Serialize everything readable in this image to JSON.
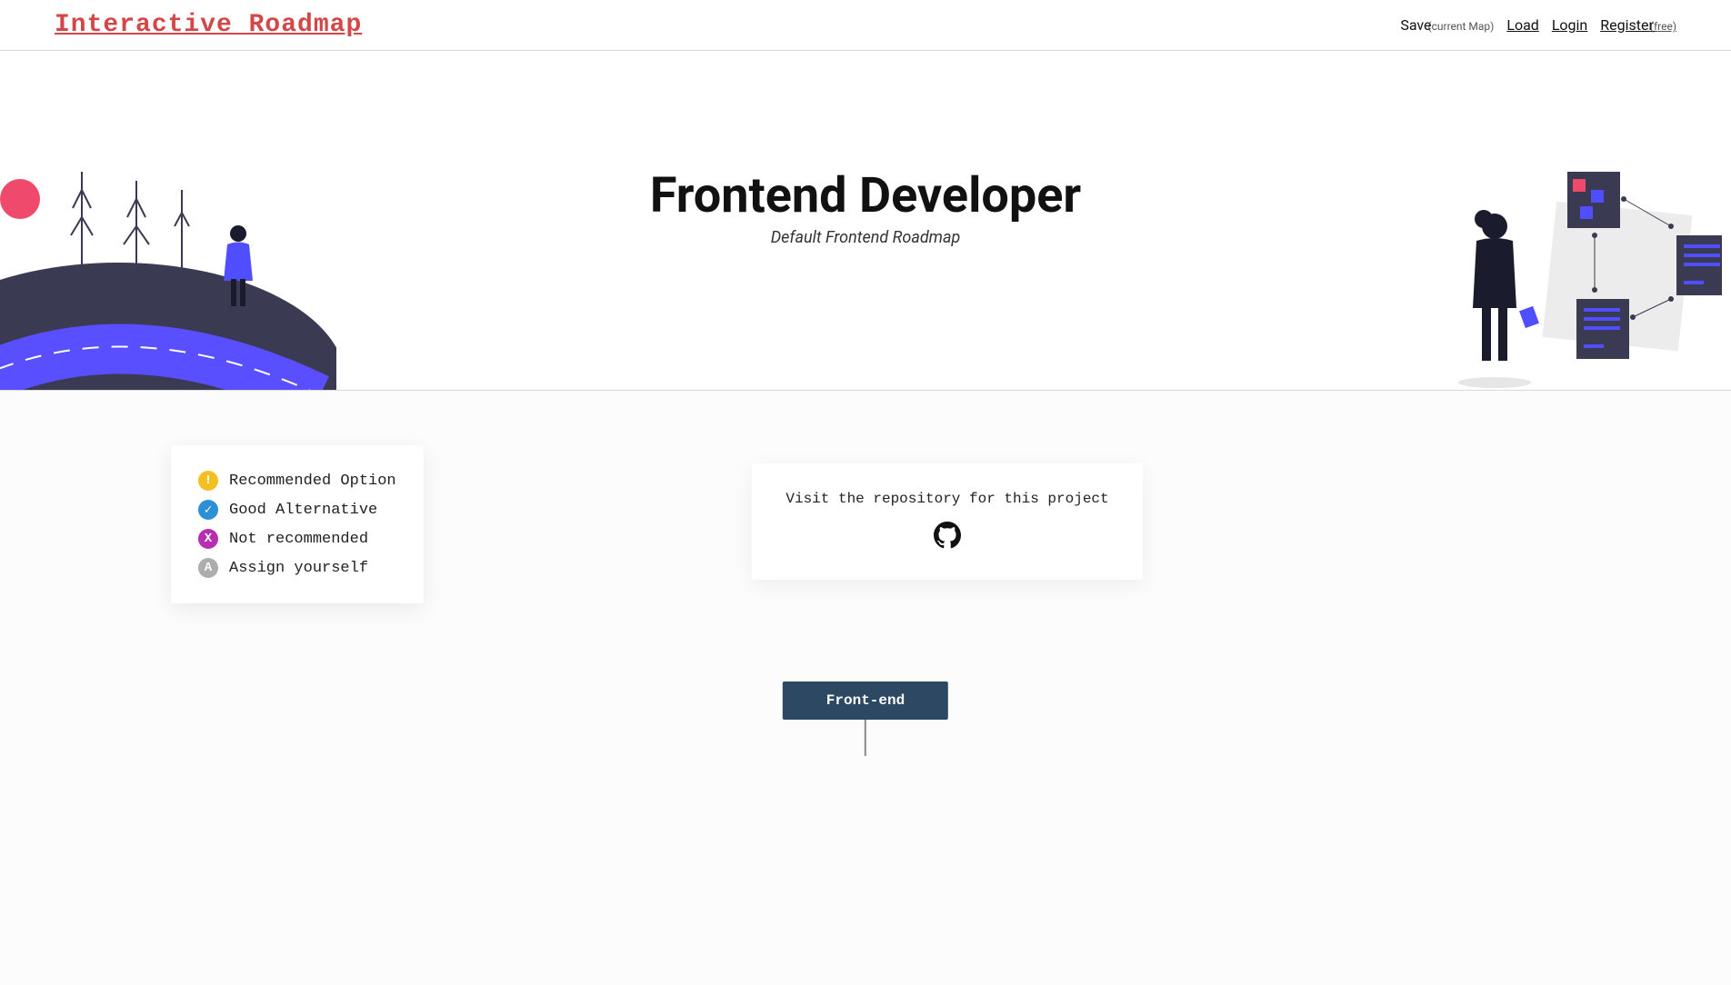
{
  "header": {
    "logo": "Interactive Roadmap",
    "nav": {
      "save": "Save",
      "save_sub": "(current Map)",
      "load": "Load",
      "login": "Login",
      "register": "Register",
      "register_sub": "(free)"
    }
  },
  "hero": {
    "title": "Frontend Developer",
    "subtitle": "Default Frontend Roadmap"
  },
  "legend": {
    "items": [
      {
        "glyph": "!",
        "color": "yellow",
        "label": "Recommended Option"
      },
      {
        "glyph": "✓",
        "color": "blue",
        "label": "Good Alternative"
      },
      {
        "glyph": "X",
        "color": "purple",
        "label": "Not recommended"
      },
      {
        "glyph": "A",
        "color": "gray",
        "label": "Assign yourself"
      }
    ]
  },
  "repo": {
    "text": "Visit the repository for this project",
    "icon": "github-icon"
  },
  "roadmap": {
    "root_node": "Front-end"
  }
}
